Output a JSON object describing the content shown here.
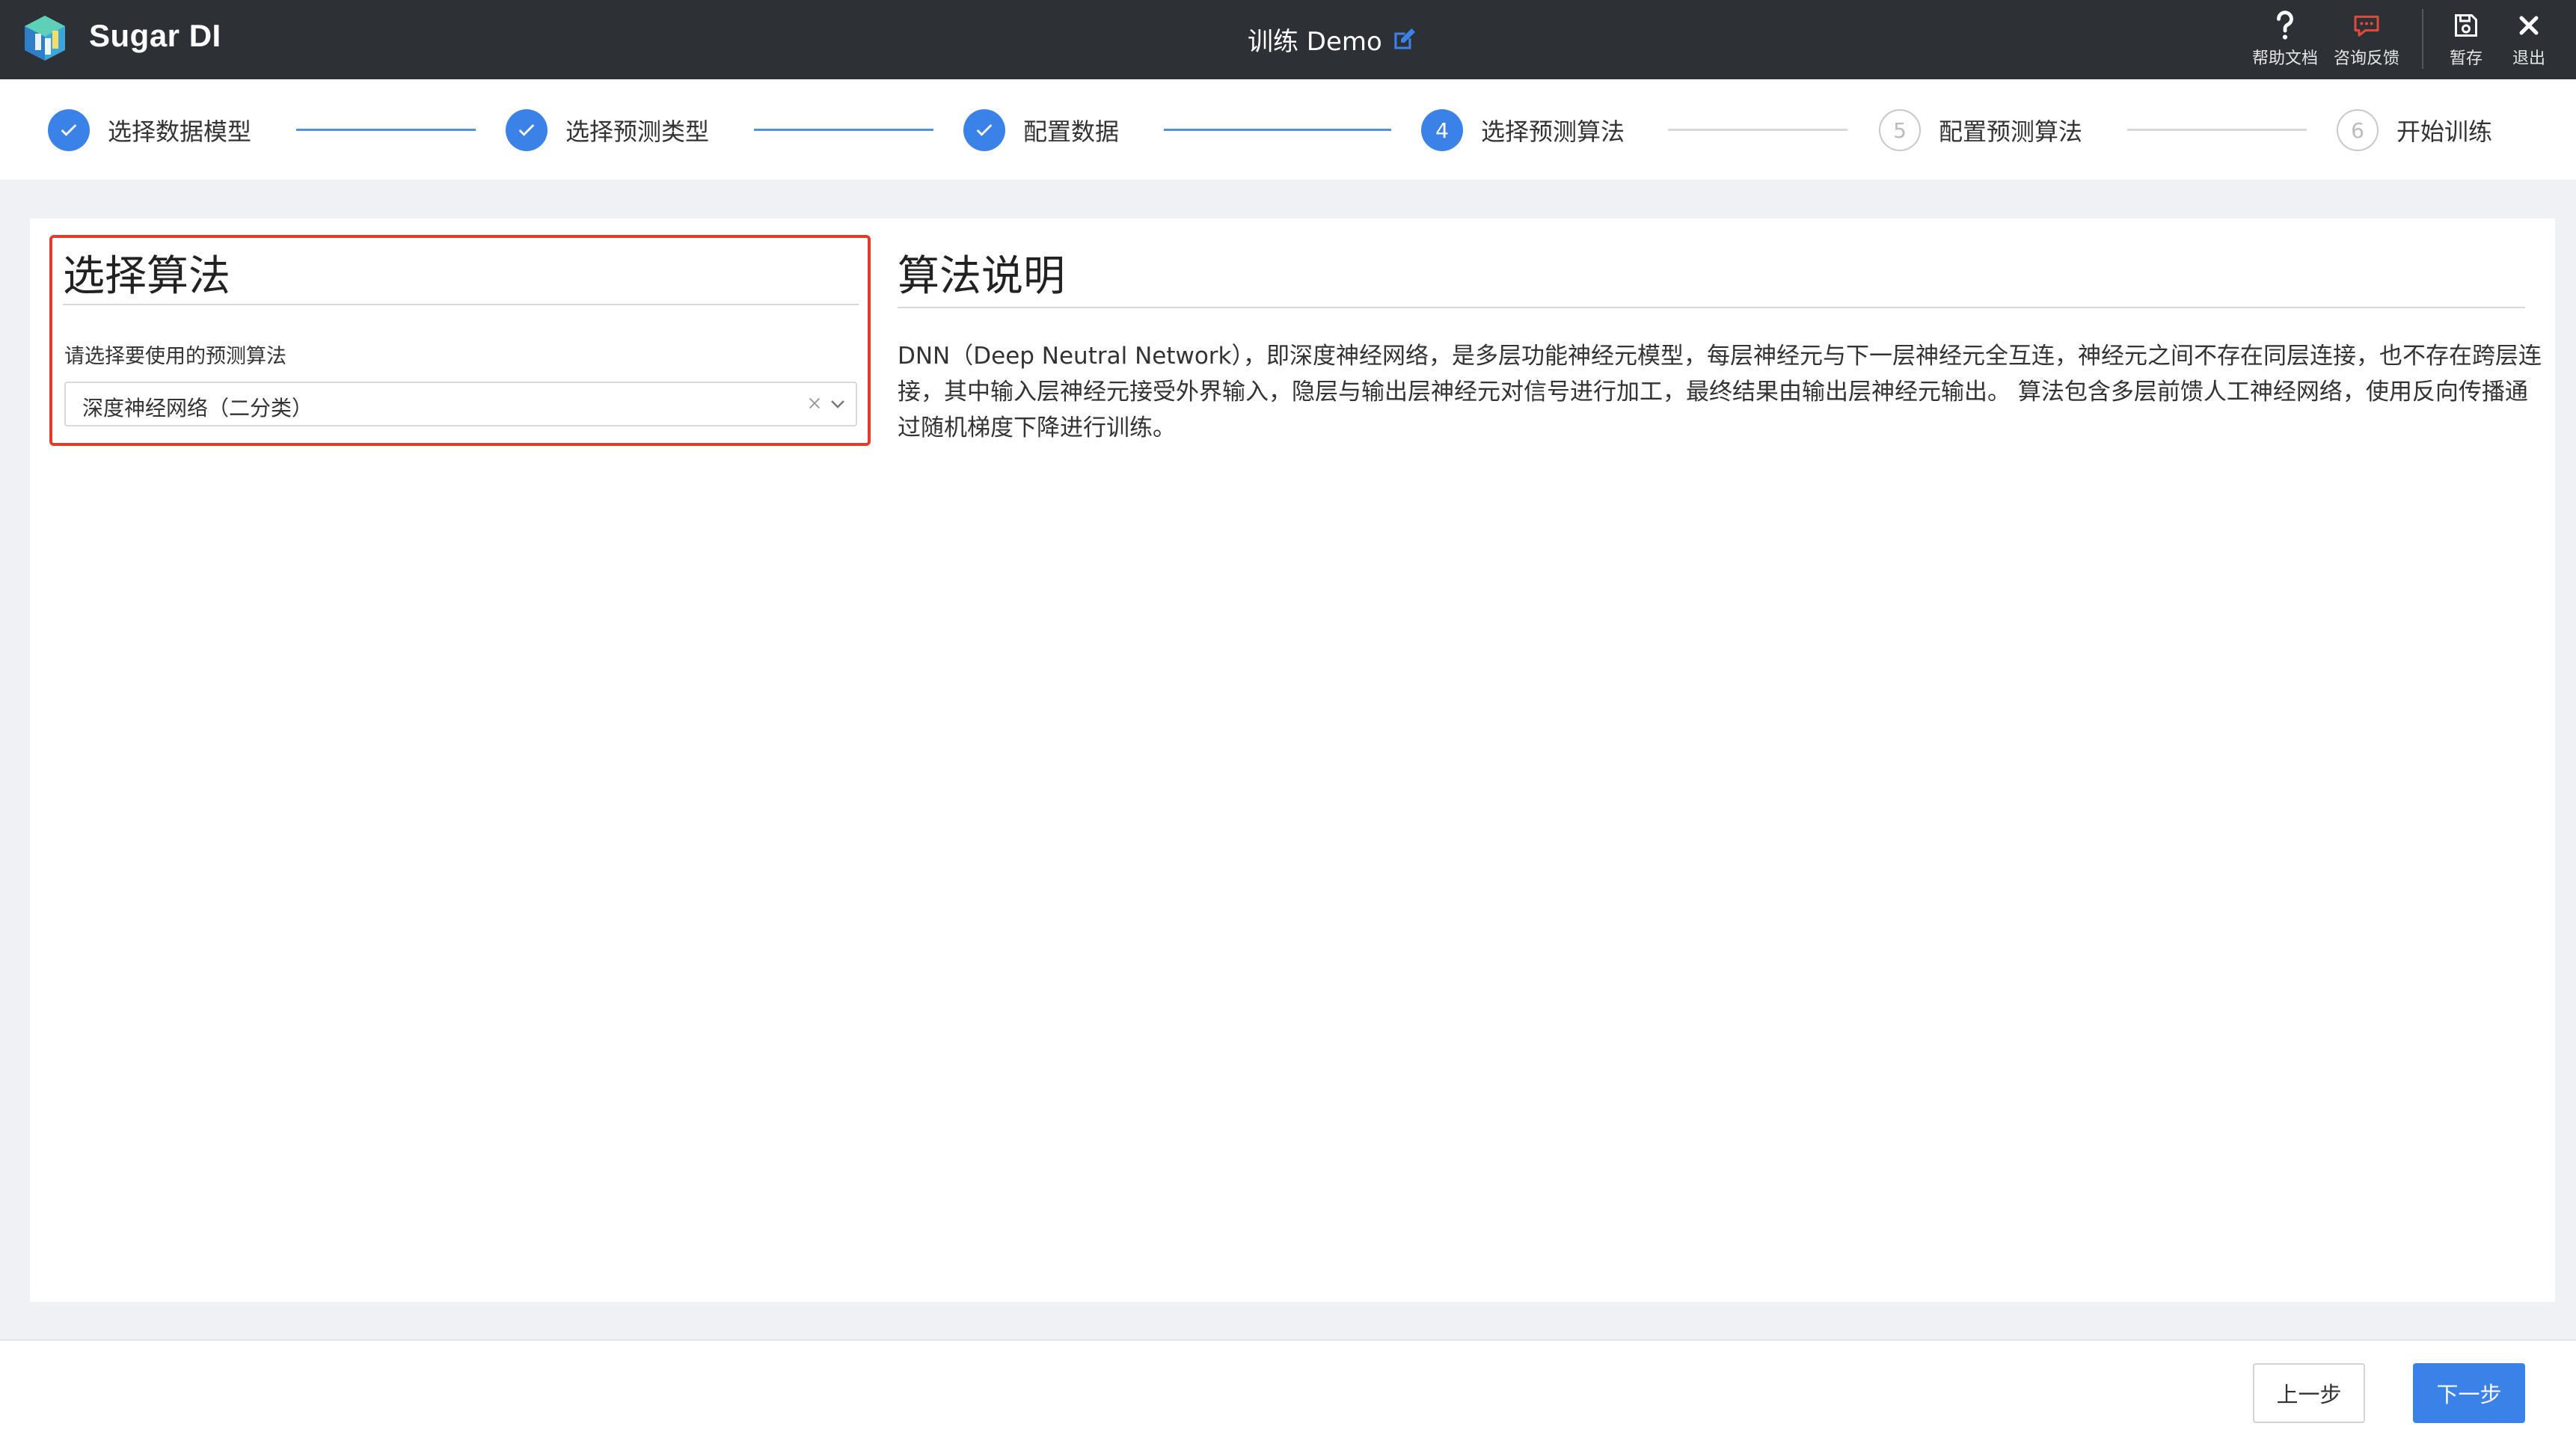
{
  "header": {
    "brand": "Sugar DI",
    "title": "训练 Demo",
    "tools": [
      {
        "id": "help",
        "label": "帮助文档",
        "icon": "question-icon"
      },
      {
        "id": "feedback",
        "label": "咨询反馈",
        "icon": "chat-bubble-icon"
      },
      {
        "id": "save",
        "label": "暂存",
        "icon": "save-icon"
      },
      {
        "id": "exit",
        "label": "退出",
        "icon": "close-icon"
      }
    ]
  },
  "steps": [
    {
      "num": "1",
      "label": "选择数据模型",
      "state": "done"
    },
    {
      "num": "2",
      "label": "选择预测类型",
      "state": "done"
    },
    {
      "num": "3",
      "label": "配置数据",
      "state": "done"
    },
    {
      "num": "4",
      "label": "选择预测算法",
      "state": "active"
    },
    {
      "num": "5",
      "label": "配置预测算法",
      "state": "pending"
    },
    {
      "num": "6",
      "label": "开始训练",
      "state": "pending"
    }
  ],
  "algorithm": {
    "title": "选择算法",
    "field_label": "请选择要使用的预测算法",
    "selected": "深度神经网络（二分类）"
  },
  "description": {
    "title": "算法说明",
    "text": "DNN（Deep Neutral Network），即深度神经网络，是多层功能神经元模型，每层神经元与下一层神经元全互连，神经元之间不存在同层连接，也不存在跨层连接，其中输入层神经元接受外界输入，隐层与输出层神经元对信号进行加工，最终结果由输出层神经元输出。 算法包含多层前馈人工神经网络，使用反向传播通过随机梯度下降进行训练。"
  },
  "footer": {
    "prev_label": "上一步",
    "next_label": "下一步"
  },
  "colors": {
    "primary": "#3b82e8",
    "header_bg": "#2d3035",
    "highlight_border": "#e23b2a"
  }
}
